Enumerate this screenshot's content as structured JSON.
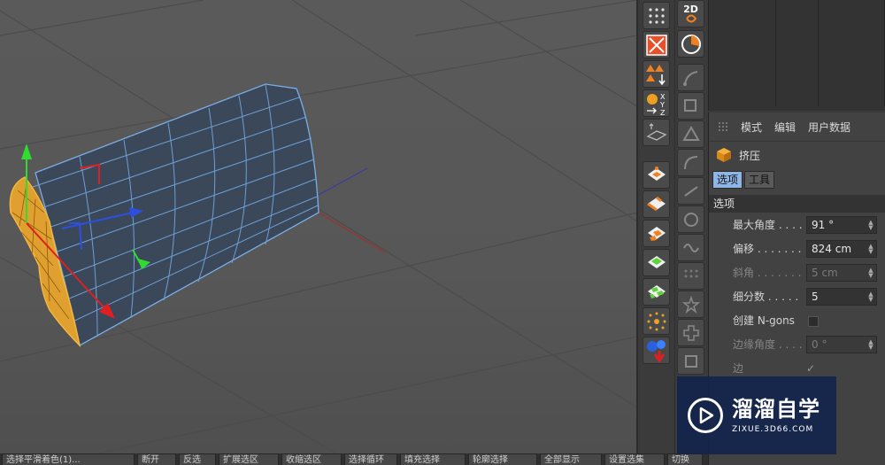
{
  "viewport": {
    "background": "#575757"
  },
  "bottom_bar": {
    "items": [
      "选择平滑着色(1)...",
      "断开",
      "反选",
      "扩展选区",
      "收缩选区",
      "选择循环",
      "填充选择",
      "轮廓选择",
      "全部显示",
      "设置选集",
      "切换"
    ]
  },
  "tools_left": {
    "items": [
      {
        "name": "dots-grid-icon"
      },
      {
        "name": "make-editable-icon"
      },
      {
        "name": "axis-mode-icon"
      },
      {
        "name": "xyz-coordinates-icon"
      },
      {
        "name": "workplane-icon"
      },
      {
        "name": "points-mode-icon"
      },
      {
        "name": "edges-mode-icon"
      },
      {
        "name": "polygons-mode-icon"
      },
      {
        "name": "uvw-points-icon"
      },
      {
        "name": "uvw-polygons-icon"
      },
      {
        "name": "snap-icon"
      },
      {
        "name": "render-icon"
      }
    ]
  },
  "tools_right": {
    "top_label": "2D",
    "items": [
      "spline-pen",
      "spline-sketch",
      "spline-arc",
      "spline-rect",
      "spline-polygon",
      "spline-bezier",
      "spline-a",
      "spline-b",
      "spline-c",
      "spline-d",
      "spline-e",
      "spline-f",
      "spline-g",
      "spline-h"
    ]
  },
  "attributes": {
    "menu": [
      "模式",
      "编辑",
      "用户数据"
    ],
    "object_name": "挤压",
    "tabs": [
      "选项",
      "工具"
    ],
    "section": "选项",
    "params": [
      {
        "label": "最大角度",
        "dots": ". . . .",
        "value": "91 °",
        "enabled": true
      },
      {
        "label": "偏移",
        "dots": ". . . . . . .",
        "value": "824 cm",
        "enabled": true
      },
      {
        "label": "斜角",
        "dots": ". . . . . . .",
        "value": "5 cm",
        "enabled": false
      },
      {
        "label": "细分数",
        "dots": ". . . . .",
        "value": "5",
        "enabled": true
      }
    ],
    "ngons_label": "创建 N-gons",
    "edge_angle": {
      "label": "边缘角度",
      "dots": ". . . .",
      "value": "0 °"
    },
    "partial_label": "边"
  },
  "watermark": {
    "title": "溜溜自学",
    "subtitle": "ZIXUE.3D66.COM"
  },
  "colors": {
    "accent": "#8fb4e6",
    "selection": "#f0a020",
    "mesh": "#3c4a5e",
    "wire": "#6d9fd6"
  }
}
